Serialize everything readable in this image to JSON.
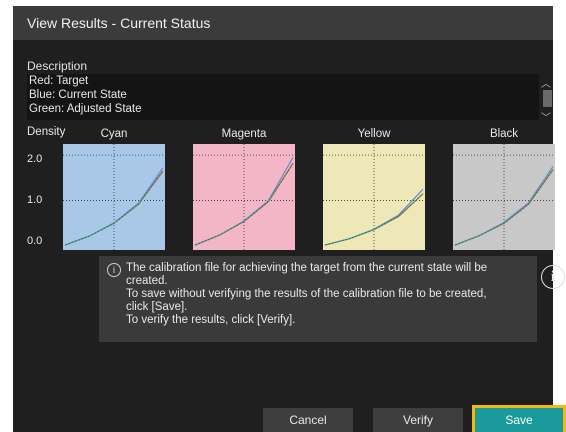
{
  "dialog": {
    "title": "View Results - Current Status",
    "description_label": "Description",
    "description_lines": [
      "Red: Target",
      "Blue: Current State",
      "Green: Adjusted State"
    ],
    "density_label": "Density",
    "y_ticks": [
      "2.0",
      "1.0",
      "0.0"
    ]
  },
  "chart_data": [
    {
      "type": "line",
      "title": "Cyan",
      "background": "#a9c8e8",
      "ylim": [
        0,
        2.2
      ],
      "grid": true,
      "x": [
        0,
        0.25,
        0.5,
        0.75,
        1.0
      ],
      "series": [
        {
          "color": "#d9534f",
          "values": [
            0.02,
            0.22,
            0.5,
            0.92,
            1.65
          ]
        },
        {
          "color": "#5b8fd6",
          "values": [
            0.02,
            0.22,
            0.51,
            0.94,
            1.72
          ]
        },
        {
          "color": "#2e8b3d",
          "values": [
            0.02,
            0.22,
            0.5,
            0.92,
            1.65
          ]
        }
      ]
    },
    {
      "type": "line",
      "title": "Magenta",
      "background": "#f2b6c6",
      "ylim": [
        0,
        2.2
      ],
      "grid": true,
      "x": [
        0,
        0.25,
        0.5,
        0.75,
        1.0
      ],
      "series": [
        {
          "color": "#d9534f",
          "values": [
            0.02,
            0.24,
            0.54,
            0.98,
            1.82
          ]
        },
        {
          "color": "#5b8fd6",
          "values": [
            0.02,
            0.24,
            0.55,
            1.0,
            1.95
          ]
        },
        {
          "color": "#2e8b3d",
          "values": [
            0.02,
            0.24,
            0.54,
            0.98,
            1.82
          ]
        }
      ]
    },
    {
      "type": "line",
      "title": "Yellow",
      "background": "#eee8b8",
      "ylim": [
        0,
        2.2
      ],
      "grid": true,
      "x": [
        0,
        0.25,
        0.5,
        0.75,
        1.0
      ],
      "series": [
        {
          "color": "#d9534f",
          "values": [
            0.02,
            0.16,
            0.36,
            0.65,
            1.15
          ]
        },
        {
          "color": "#5b8fd6",
          "values": [
            0.02,
            0.16,
            0.37,
            0.68,
            1.25
          ]
        },
        {
          "color": "#2e8b3d",
          "values": [
            0.02,
            0.16,
            0.36,
            0.65,
            1.15
          ]
        }
      ]
    },
    {
      "type": "line",
      "title": "Black",
      "background": "#c8c8c8",
      "ylim": [
        0,
        2.2
      ],
      "grid": true,
      "x": [
        0,
        0.25,
        0.5,
        0.75,
        1.0
      ],
      "series": [
        {
          "color": "#d9534f",
          "values": [
            0.02,
            0.23,
            0.5,
            0.92,
            1.68
          ]
        },
        {
          "color": "#5b8fd6",
          "values": [
            0.02,
            0.23,
            0.52,
            0.95,
            1.75
          ]
        },
        {
          "color": "#2e8b3d",
          "values": [
            0.02,
            0.23,
            0.5,
            0.92,
            1.68
          ]
        }
      ]
    }
  ],
  "info": {
    "lines": [
      "The calibration file for achieving the target from the current state will be",
      "created.",
      "To save without verifying the results of the calibration file to be created,",
      "click [Save].",
      "To verify the results, click [Verify]."
    ],
    "icon": "i",
    "help_icon": "i"
  },
  "buttons": {
    "cancel": "Cancel",
    "verify": "Verify",
    "save": "Save",
    "save_color": "#1a9a9a",
    "highlight_color": "#f2b90f"
  }
}
